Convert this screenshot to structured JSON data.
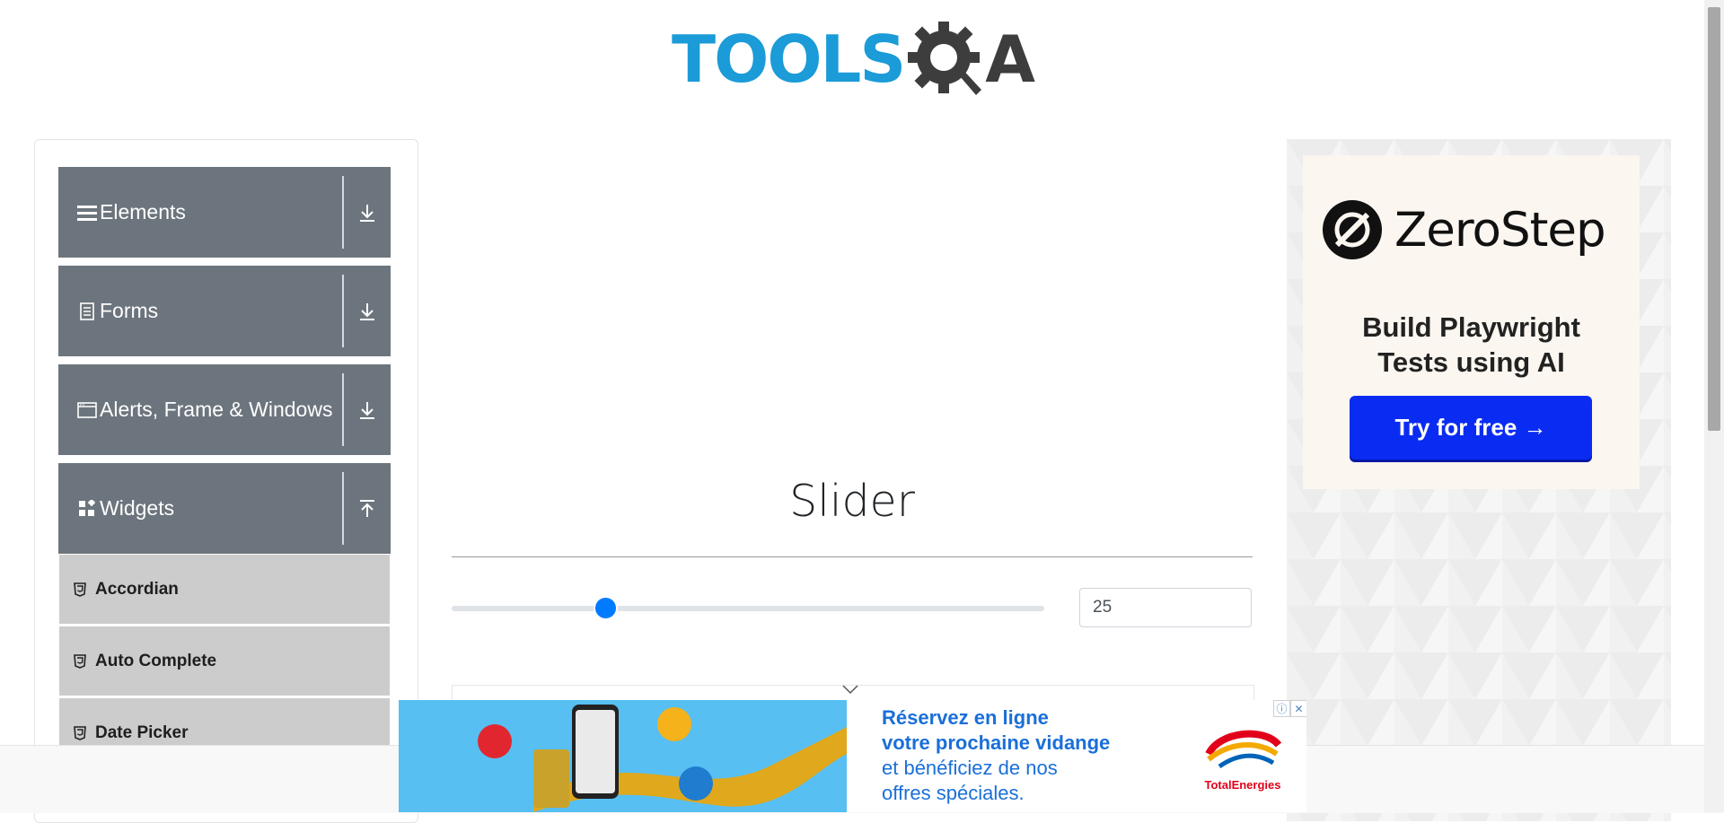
{
  "header": {
    "logo_tools": "TOOLS",
    "logo_qa": "A"
  },
  "sidebar": {
    "groups": [
      {
        "label": "Elements",
        "icon": "hamburger-icon",
        "expanded": false
      },
      {
        "label": "Forms",
        "icon": "document-icon",
        "expanded": false
      },
      {
        "label": "Alerts, Frame & Windows",
        "icon": "window-icon",
        "expanded": false
      },
      {
        "label": "Widgets",
        "icon": "widgets-icon",
        "expanded": true
      }
    ],
    "widget_items": [
      {
        "label": "Accordian",
        "icon": "html5-icon"
      },
      {
        "label": "Auto Complete",
        "icon": "html5-icon"
      },
      {
        "label": "Date Picker",
        "icon": "html5-icon"
      }
    ]
  },
  "main": {
    "title": "Slider",
    "slider": {
      "min": 0,
      "max": 100,
      "value": 25
    },
    "value_field": "25"
  },
  "right_ad": {
    "brand": "ZeroStep",
    "tagline_line1": "Build Playwright",
    "tagline_line2": "Tests using AI",
    "button": "Try for free →"
  },
  "bottom_ad": {
    "line1": "Réservez en ligne",
    "line2": "votre prochaine vidange",
    "line3": "et bénéficiez de nos",
    "line4": "offres spéciales.",
    "brand": "TotalEnergies",
    "info_icon": "ⓘ",
    "close_icon": "✕"
  },
  "colors": {
    "accent": "#007bff",
    "sidebar_group": "#6c757d",
    "sidebar_item": "#cccccc",
    "ad_button": "#0a2cf2"
  }
}
